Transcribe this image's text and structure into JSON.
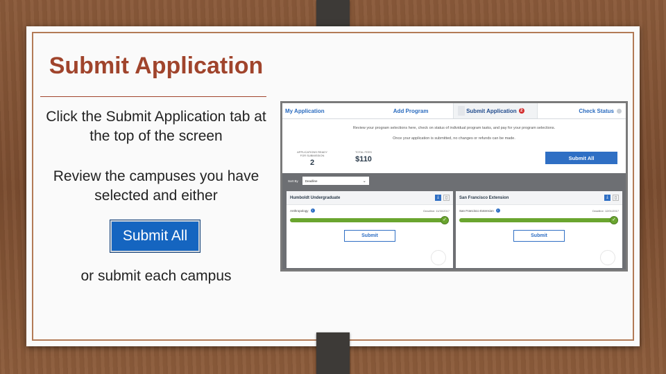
{
  "slide": {
    "title": "Submit Application",
    "paragraph1": "Click the Submit Application tab at the top of the screen",
    "paragraph2": "Review the campuses you have selected and either",
    "button_label": "Submit All",
    "paragraph3": "or submit each campus",
    "colors": {
      "title": "#a0442c",
      "button": "#1565c0"
    }
  },
  "screenshot": {
    "tabs": [
      {
        "label": "My Application"
      },
      {
        "label": "Add Program"
      },
      {
        "label": "Submit Application",
        "badge": "2",
        "active": true
      },
      {
        "label": "Check Status"
      }
    ],
    "instruction1": "Review your program selections here, check on status of individual program tasks, and pay for your program selections.",
    "instruction2": "Once your application is submitted, no changes or refunds can be made.",
    "summary": {
      "ready_label": "APPLICATIONS READY FOR SUBMISSION",
      "ready_value": "2",
      "total_label": "TOTAL FEES",
      "total_value": "$110"
    },
    "submit_all_label": "Submit All",
    "sort_label": "Sort By",
    "sort_value": "Deadline",
    "campuses": [
      {
        "name": "Humboldt Undergraduate",
        "program": "Anthropology",
        "deadline": "Deadline: 11/30/2017",
        "progress": 1.0,
        "submit_label": "Submit"
      },
      {
        "name": "San Francisco Extension",
        "program": "San Francisco Extension",
        "deadline": "Deadline: 12/01/2017",
        "progress": 1.0,
        "submit_label": "Submit"
      }
    ]
  }
}
